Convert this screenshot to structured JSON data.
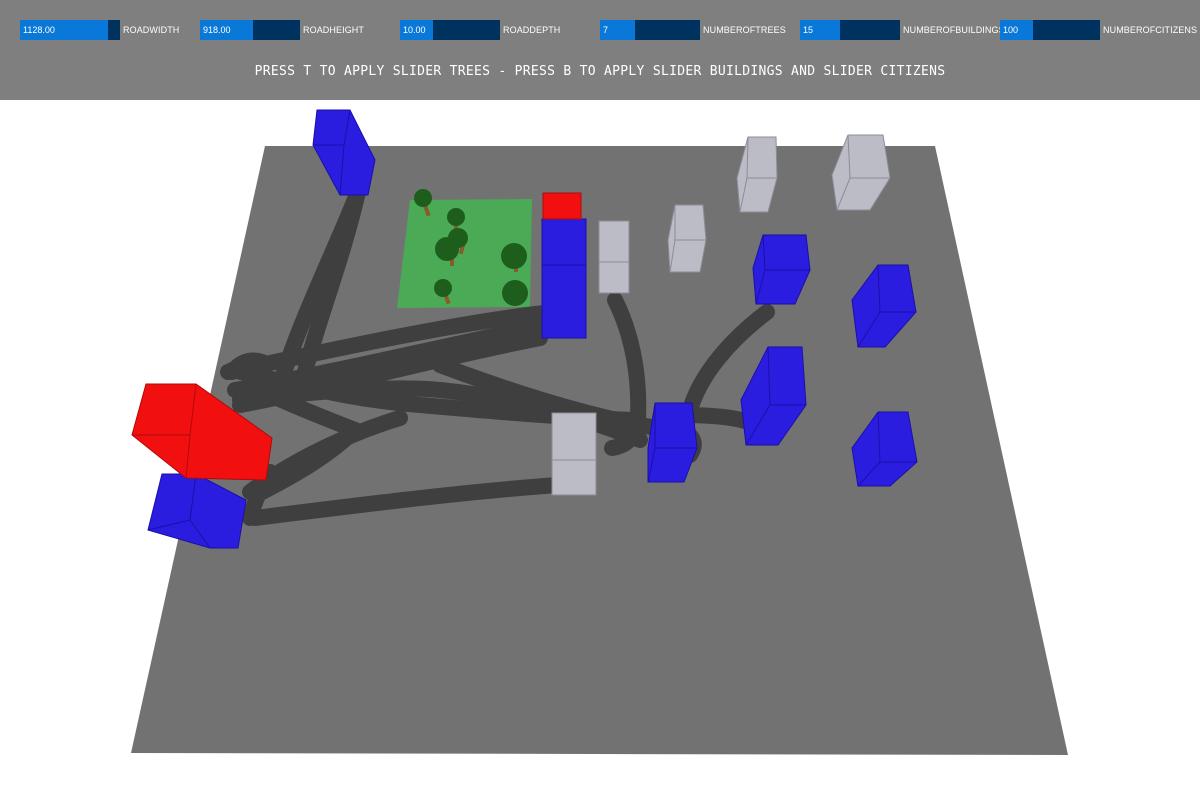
{
  "sliders": [
    {
      "id": "roadwidth",
      "value": "1128.00",
      "label": "ROADWIDTH",
      "fill_fraction": 0.88
    },
    {
      "id": "roadheight",
      "value": "918.00",
      "label": "ROADHEIGHT",
      "fill_fraction": 0.53
    },
    {
      "id": "roaddepth",
      "value": "10.00",
      "label": "ROADDEPTH",
      "fill_fraction": 0.33
    },
    {
      "id": "numberoftrees",
      "value": "7",
      "label": "NUMBEROFTREES",
      "fill_fraction": 0.35
    },
    {
      "id": "numberofbuildings",
      "value": "15",
      "label": "NUMBEROFBUILDINGS",
      "fill_fraction": 0.4
    },
    {
      "id": "numberofcitizens",
      "value": "100",
      "label": "NUMBEROFCITIZENS",
      "fill_fraction": 0.33
    }
  ],
  "hint": "PRESS T TO APPLY SLIDER TREES - PRESS B TO APPLY SLIDER BUILDINGS AND SLIDER CITIZENS",
  "colors": {
    "topbar": "#7f7f7f",
    "slider_track": "#00325f",
    "slider_fill": "#0a78d8",
    "ground": "#737272",
    "road": "#3f3f3f",
    "park": "#4aaa55",
    "tree": "#1e5e1c",
    "trunk": "#8b5a2b",
    "building_blue": "#2a1de0",
    "building_red": "#f20f0f",
    "building_gray": "#bcbcc6"
  }
}
